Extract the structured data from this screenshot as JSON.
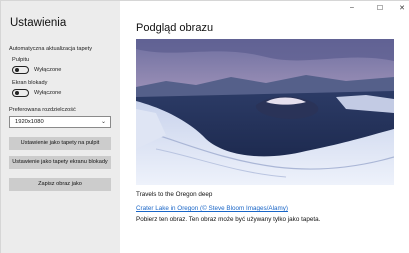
{
  "sidebar": {
    "title": "Ustawienia",
    "auto_update_label": "Automatyczna aktualizacja tapety",
    "desktop_label": "Pulpitu",
    "desktop_state": "Wyłączone",
    "lockscreen_label": "Ekran blokady",
    "lockscreen_state": "Wyłączone",
    "resolution_label": "Preferowana rozdzielczość",
    "resolution_value": "1920x1080",
    "buttons": {
      "set_desktop": "Ustawienie jako tapety na pulpit",
      "set_lockscreen": "Ustawienie jako tapety ekranu blokady",
      "save_image": "Zapisz obraz jako"
    }
  },
  "main": {
    "heading": "Podgląd obrazu",
    "caption": "Travels to the Oregon deep",
    "credit_link": "Crater Lake in Oregon (© Steve Bloom Images/Alamy)",
    "note": "Pobierz ten obraz. Ten obraz może być używany tylko jako tapeta."
  },
  "window_controls": {
    "minimize": "–",
    "maximize": "☐",
    "close": "✕"
  },
  "toggles": {
    "desktop_on": false,
    "lockscreen_on": false
  }
}
